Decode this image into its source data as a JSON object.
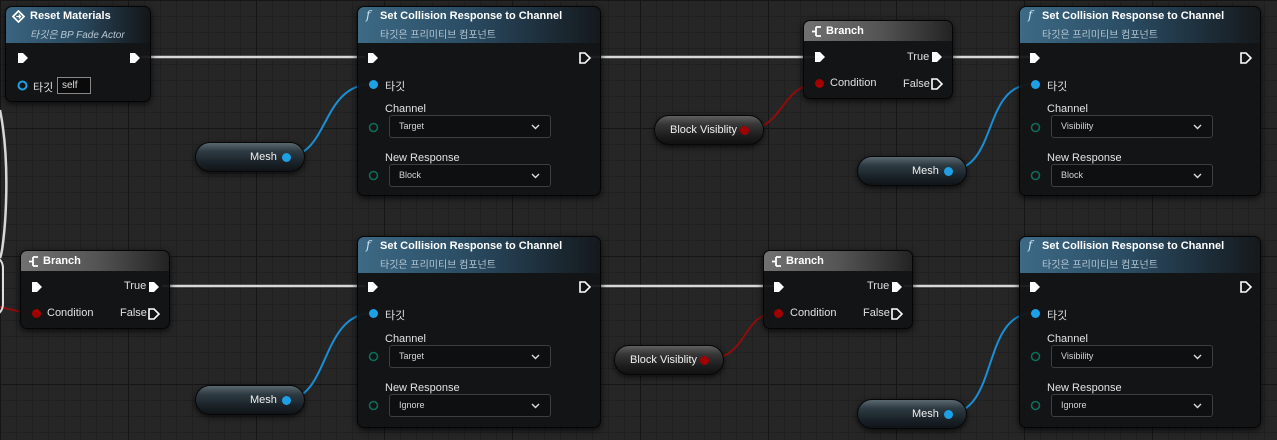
{
  "colors": {
    "exec": "#ffffff",
    "object_pin": "#1ea0e6",
    "bool_pin": "#a00000",
    "function_header": "#3d6a86",
    "branch_header": "#717171"
  },
  "reset_materials": {
    "title": "Reset Materials",
    "subtitle": "타깃은 BP Fade Actor",
    "target_label": "타깃",
    "target_value": "self",
    "icon": "event-diamond-icon"
  },
  "set_collision_1": {
    "title": "Set Collision Response to Channel",
    "subtitle": "타깃은 프리미티브 컴포넌트",
    "target_label": "타깃",
    "channel_label": "Channel",
    "channel_value": "Target",
    "response_label": "New Response",
    "response_value": "Block"
  },
  "branch_1": {
    "title": "Branch",
    "true_label": "True",
    "false_label": "False",
    "condition_label": "Condition"
  },
  "set_collision_2": {
    "title": "Set Collision Response to Channel",
    "subtitle": "타깃은 프리미티브 컴포넌트",
    "target_label": "타깃",
    "channel_label": "Channel",
    "channel_value": "Visibility",
    "response_label": "New Response",
    "response_value": "Block"
  },
  "branch_2": {
    "title": "Branch",
    "true_label": "True",
    "false_label": "False",
    "condition_label": "Condition"
  },
  "set_collision_3": {
    "title": "Set Collision Response to Channel",
    "subtitle": "타깃은 프리미티브 컴포넌트",
    "target_label": "타깃",
    "channel_label": "Channel",
    "channel_value": "Target",
    "response_label": "New Response",
    "response_value": "Ignore"
  },
  "branch_3": {
    "title": "Branch",
    "true_label": "True",
    "false_label": "False",
    "condition_label": "Condition"
  },
  "set_collision_4": {
    "title": "Set Collision Response to Channel",
    "subtitle": "타깃은 프리미티브 컴포넌트",
    "target_label": "타깃",
    "channel_label": "Channel",
    "channel_value": "Visibility",
    "response_label": "New Response",
    "response_value": "Ignore"
  },
  "variables": {
    "mesh_1": "Mesh",
    "mesh_2": "Mesh",
    "mesh_3": "Mesh",
    "mesh_4": "Mesh",
    "block_visibility_1": "Block Visiblity",
    "block_visibility_2": "Block Visiblity"
  }
}
